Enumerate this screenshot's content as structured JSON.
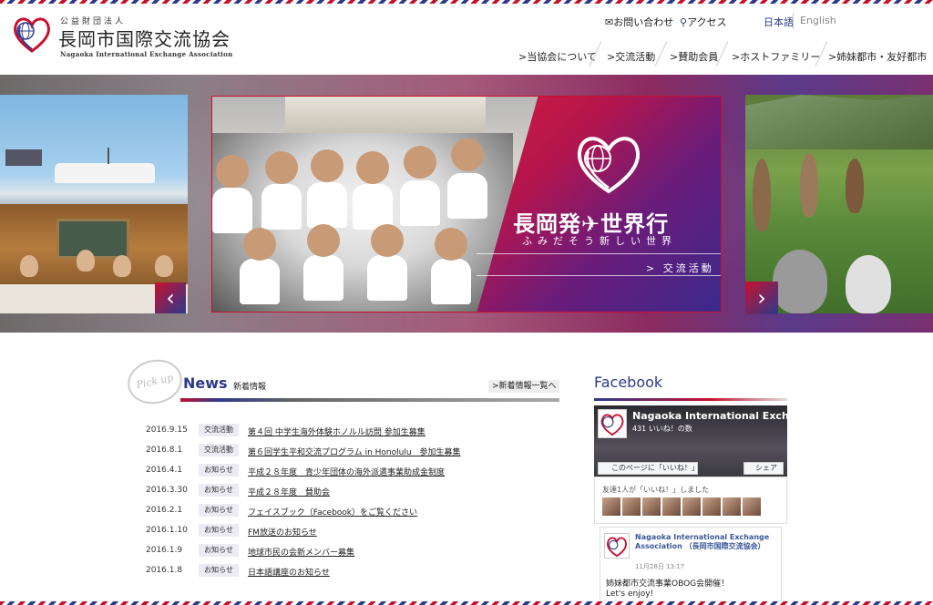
{
  "header": {
    "logo": {
      "small": "公益財団法人",
      "japanese": "長岡市国際交流協会",
      "english": "Nagaoka International Exchange Association"
    },
    "utility": {
      "contact": "お問い合わせ",
      "access": "アクセス",
      "lang_ja": "日本語",
      "lang_en": "English"
    },
    "nav": [
      {
        "label": "当協会について"
      },
      {
        "label": "交流活動"
      },
      {
        "label": "賛助会員"
      },
      {
        "label": "ホストファミリー"
      },
      {
        "label": "姉妹都市・友好都市"
      }
    ]
  },
  "hero": {
    "headline": "長岡発✈世界行",
    "subhead": "ふみだそう新しい世界",
    "link": "交流活動",
    "prev": "‹",
    "next": "›"
  },
  "news": {
    "pickup": "Pick up",
    "title": "News",
    "subtitle": "新着情報",
    "more": "新着情報一覧へ",
    "items": [
      {
        "date": "2016.9.15",
        "category": "交流活動",
        "text": "第４回 中学生海外体験ホノルル訪問 参加生募集"
      },
      {
        "date": "2016.8.1",
        "category": "交流活動",
        "text": "第６回学生平和交流プログラム in Honolulu　参加生募集"
      },
      {
        "date": "2016.4.1",
        "category": "お知らせ",
        "text": "平成２８年度　青少年団体の海外派遣事業助成金制度"
      },
      {
        "date": "2016.3.30",
        "category": "お知らせ",
        "text": "平成２８年度　賛助会"
      },
      {
        "date": "2016.2.1",
        "category": "お知らせ",
        "text": "フェイスブック（Facebook）をご覧ください"
      },
      {
        "date": "2016.1.10",
        "category": "お知らせ",
        "text": "FM放送のお知らせ"
      },
      {
        "date": "2016.1.9",
        "category": "お知らせ",
        "text": "地球市民の会新メンバー募集"
      },
      {
        "date": "2016.1.8",
        "category": "お知らせ",
        "text": "日本語講座のお知らせ"
      }
    ]
  },
  "facebook": {
    "heading": "Facebook",
    "page_name": "Nagaoka International Exch...",
    "likes": "431 いいね！の数",
    "like_button": "このページに「いいね！」",
    "share_button": "シェア",
    "friends_text": "友達1人が「いいね！」しました",
    "post_author": "Nagaoka International Exchange Association （長岡市国際交流協会）",
    "post_time": "11月28日 13:17",
    "post_line1": "姉妹都市交流事業OBOG会開催！",
    "post_line2": "Let's enjoy!"
  },
  "colors": {
    "brand_red": "#c8102e",
    "brand_navy": "#2d3a8c"
  },
  "icons": [
    "envelope-icon",
    "location-pin-icon",
    "chevron-right-icon",
    "chevron-left-icon",
    "airplane-icon",
    "facebook-icon",
    "share-icon"
  ]
}
